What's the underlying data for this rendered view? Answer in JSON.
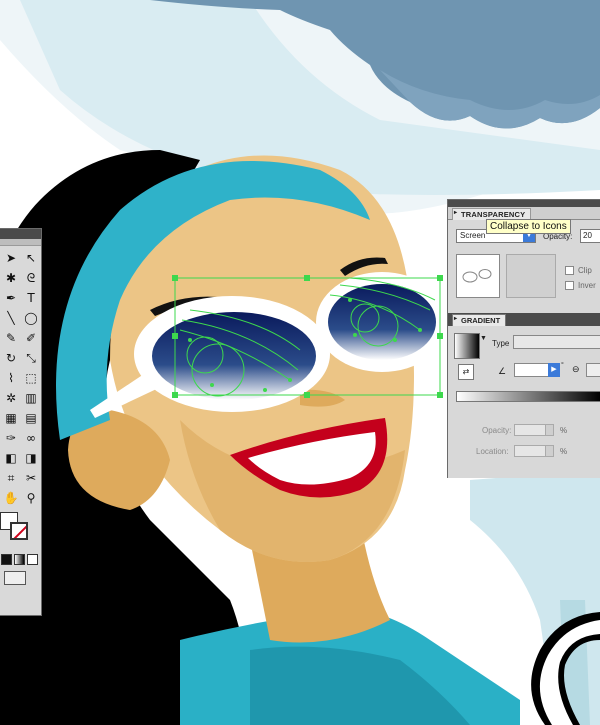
{
  "colors": {
    "sky": "#ffffff",
    "cloud": "#6f95b1",
    "headband": "#2fb2c9",
    "hair": "#000000",
    "skin": "#ecc586",
    "skin_shadow": "#deaa5c",
    "lips": "#c4001c",
    "selection": "#3dd84d",
    "tooltip_bg": "#ffffc8",
    "panel_bg": "#d8d8d8",
    "accent_blue": "#3b7ad9"
  },
  "tools_panel": {
    "tools": [
      {
        "name": "selection-tool",
        "glyph": "➤"
      },
      {
        "name": "direct-selection-tool",
        "glyph": "↖"
      },
      {
        "name": "magic-wand-tool",
        "glyph": "✱"
      },
      {
        "name": "lasso-tool",
        "glyph": "ᘓ"
      },
      {
        "name": "pen-tool",
        "glyph": "✒"
      },
      {
        "name": "type-tool",
        "glyph": "T"
      },
      {
        "name": "line-tool",
        "glyph": "╲"
      },
      {
        "name": "ellipse-tool",
        "glyph": "◯"
      },
      {
        "name": "paintbrush-tool",
        "glyph": "✎"
      },
      {
        "name": "pencil-tool",
        "glyph": "✐"
      },
      {
        "name": "rotate-tool",
        "glyph": "↻"
      },
      {
        "name": "scale-tool",
        "glyph": "⤡"
      },
      {
        "name": "warp-tool",
        "glyph": "⌇"
      },
      {
        "name": "free-transform-tool",
        "glyph": "⬚"
      },
      {
        "name": "symbol-sprayer-tool",
        "glyph": "✲"
      },
      {
        "name": "graph-tool",
        "glyph": "▥"
      },
      {
        "name": "mesh-tool",
        "glyph": "▦"
      },
      {
        "name": "gradient-tool",
        "glyph": "▤"
      },
      {
        "name": "eyedropper-tool",
        "glyph": "✑"
      },
      {
        "name": "blend-tool",
        "glyph": "∞"
      },
      {
        "name": "live-paint-tool",
        "glyph": "◧"
      },
      {
        "name": "live-paint-selection-tool",
        "glyph": "◨"
      },
      {
        "name": "crop-tool",
        "glyph": "⌗"
      },
      {
        "name": "slice-tool",
        "glyph": "✂"
      },
      {
        "name": "hand-tool",
        "glyph": "✋"
      },
      {
        "name": "zoom-tool",
        "glyph": "⚲"
      }
    ]
  },
  "transparency_panel": {
    "tab_label": "TRANSPARENCY",
    "blend_mode": "Screen",
    "opacity_label": "Opacity:",
    "opacity_value": "20",
    "clip_label": "Clip",
    "invert_label": "Inver"
  },
  "tooltip": {
    "text": "Collapse to Icons"
  },
  "gradient_panel": {
    "tab_label": "GRADIENT",
    "type_label": "Type",
    "opacity_label": "Opacity:",
    "location_label": "Location:",
    "percent": "%"
  }
}
